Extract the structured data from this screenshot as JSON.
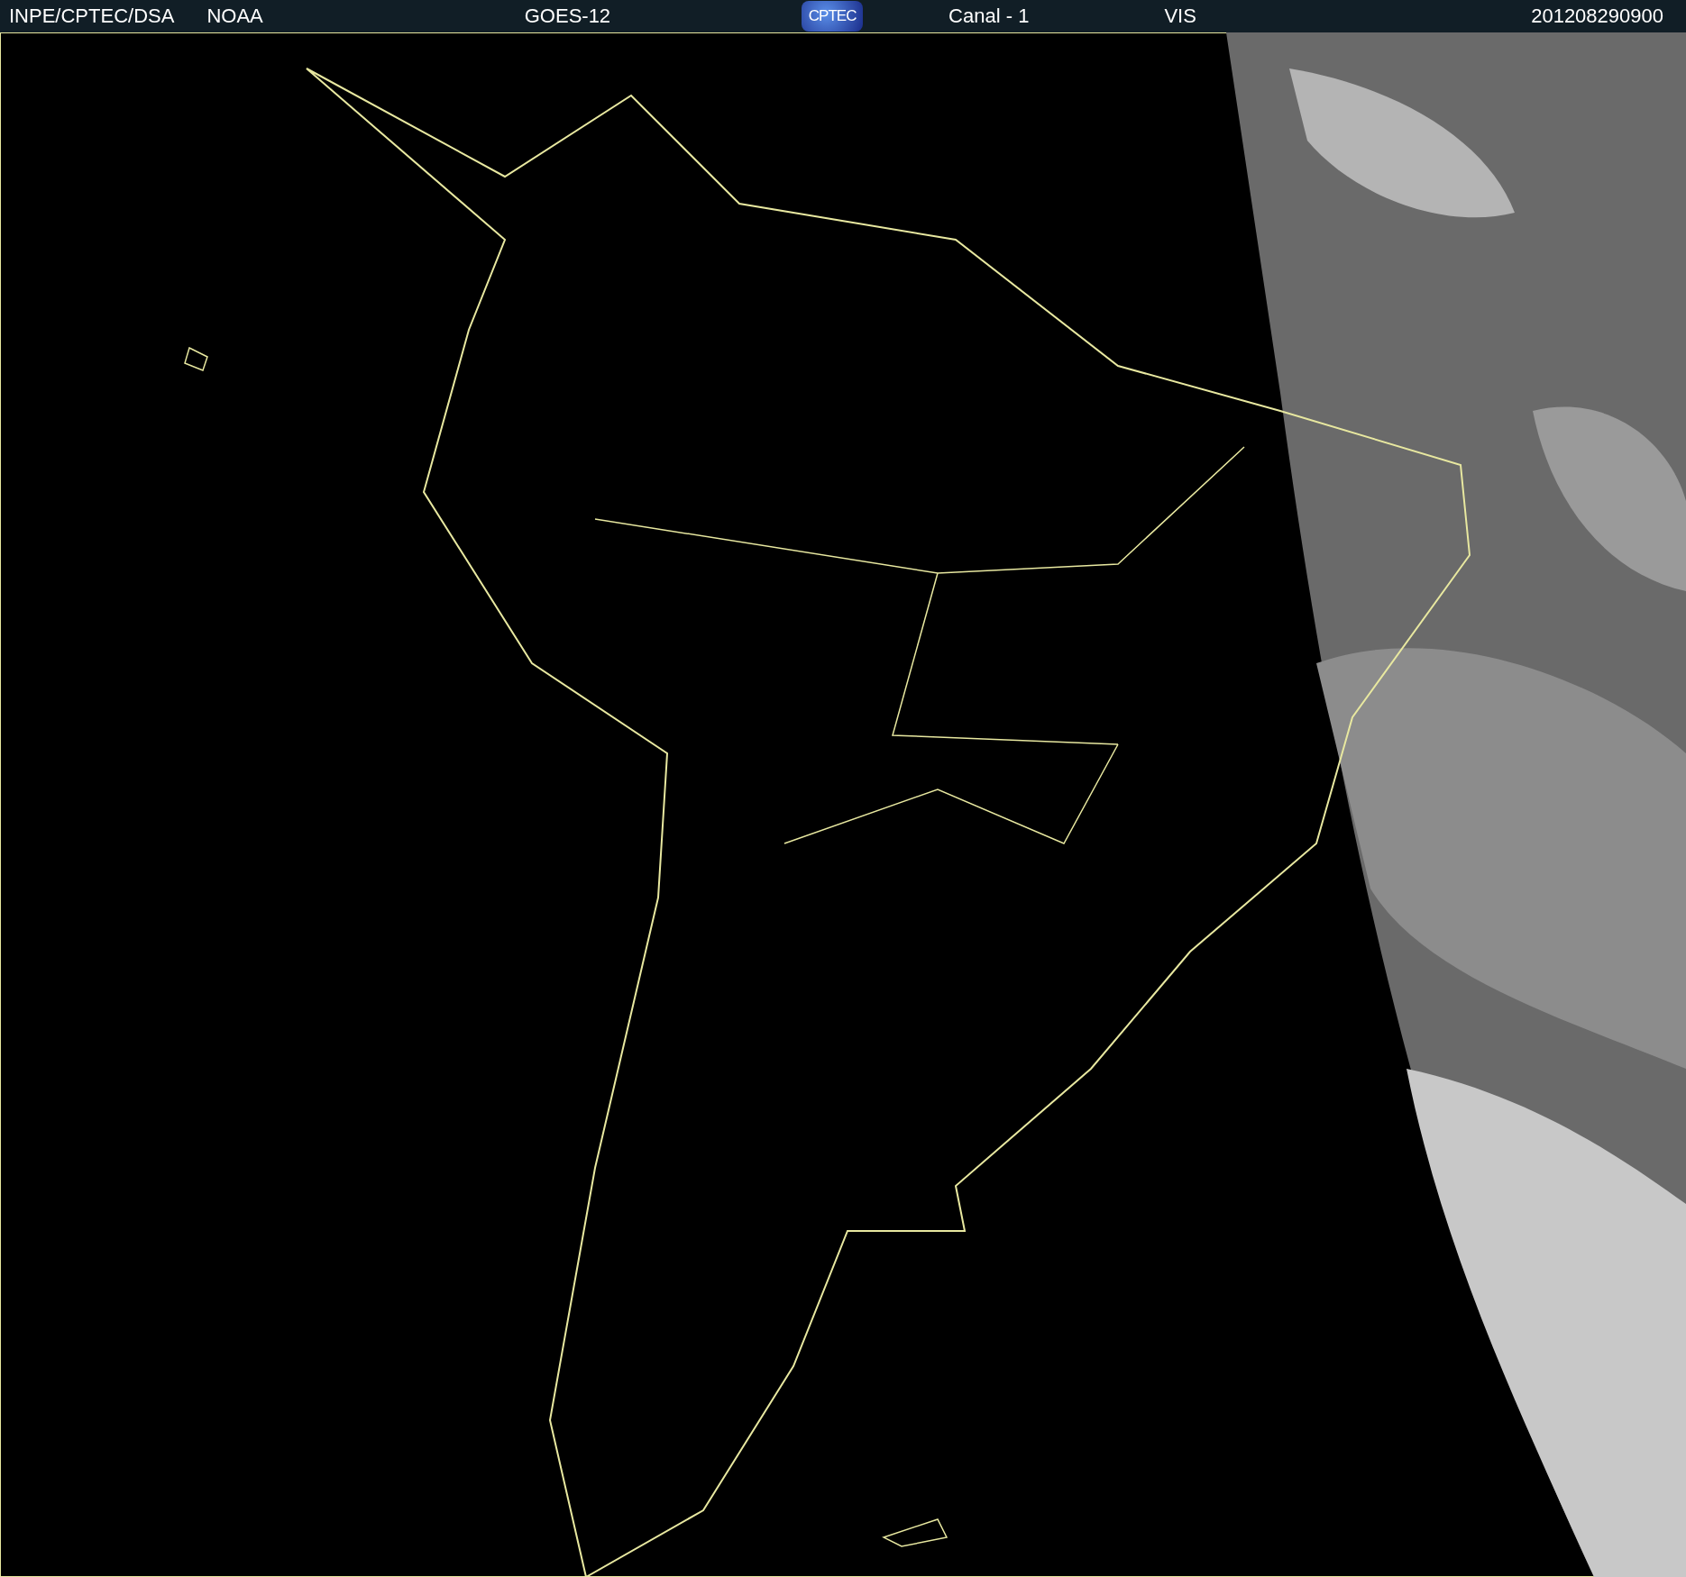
{
  "header": {
    "source": "INPE/CPTEC/DSA",
    "agency": "NOAA",
    "satellite": "GOES-12",
    "logo": "CPTEC",
    "channel": "Canal - 1",
    "band": "VIS",
    "timestamp": "201208290900"
  }
}
